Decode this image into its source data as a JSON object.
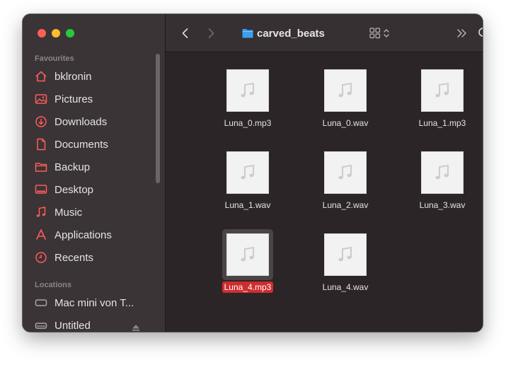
{
  "window": {
    "title": "carved_beats"
  },
  "sidebar": {
    "favourites_label": "Favourites",
    "favourites": [
      {
        "label": "bklronin",
        "icon": "home-icon"
      },
      {
        "label": "Pictures",
        "icon": "pictures-icon"
      },
      {
        "label": "Downloads",
        "icon": "downloads-icon"
      },
      {
        "label": "Documents",
        "icon": "documents-icon"
      },
      {
        "label": "Backup",
        "icon": "folder-icon"
      },
      {
        "label": "Desktop",
        "icon": "desktop-icon"
      },
      {
        "label": "Music",
        "icon": "music-icon"
      },
      {
        "label": "Applications",
        "icon": "applications-icon"
      },
      {
        "label": "Recents",
        "icon": "clock-icon"
      }
    ],
    "locations_label": "Locations",
    "locations": [
      {
        "label": "Mac mini von T...",
        "icon": "computer-icon"
      },
      {
        "label": "Untitled",
        "icon": "drive-icon"
      }
    ]
  },
  "files": [
    {
      "name": "Luna_0.mp3",
      "selected": false
    },
    {
      "name": "Luna_0.wav",
      "selected": false
    },
    {
      "name": "Luna_1.mp3",
      "selected": false
    },
    {
      "name": "Luna_1.wav",
      "selected": false
    },
    {
      "name": "Luna_2.wav",
      "selected": false
    },
    {
      "name": "Luna_3.wav",
      "selected": false
    },
    {
      "name": "Luna_4.mp3",
      "selected": true
    },
    {
      "name": "Luna_4.wav",
      "selected": false
    }
  ],
  "colors": {
    "accent": "#ff5b5b",
    "selection": "#cf2d2d",
    "folder": "#3aa0f0"
  }
}
